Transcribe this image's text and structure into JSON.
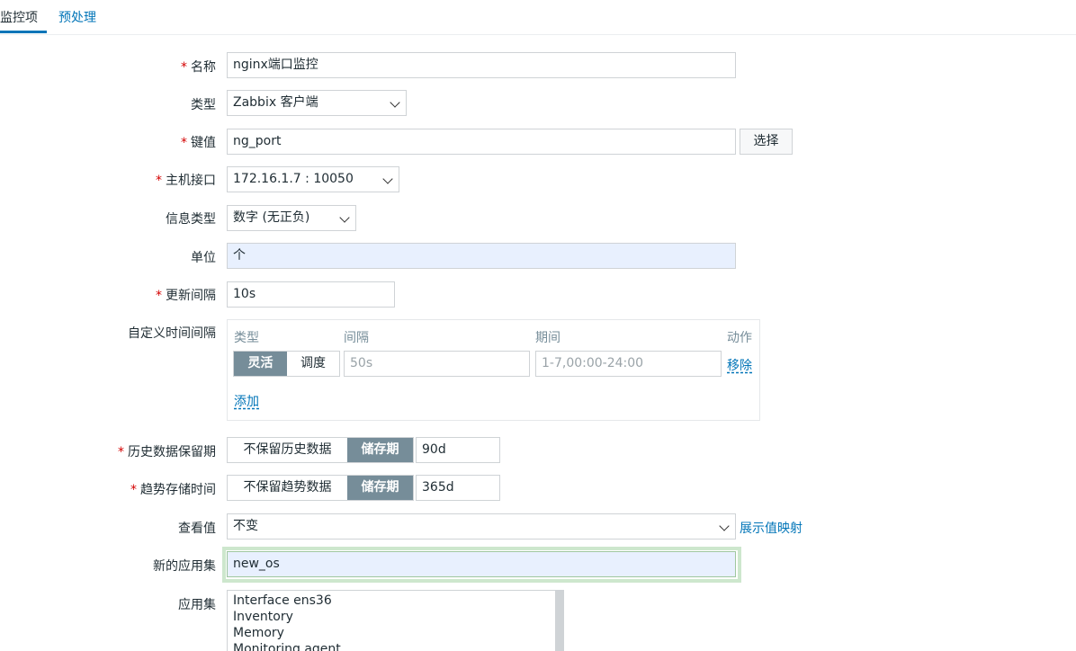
{
  "tabs": [
    {
      "label": "监控项",
      "active": true
    },
    {
      "label": "预处理",
      "active": false
    }
  ],
  "form": {
    "name": {
      "label": "名称",
      "value": "nginx端口监控",
      "required": true
    },
    "type": {
      "label": "类型",
      "value": "Zabbix 客户端"
    },
    "key": {
      "label": "键值",
      "value": "ng_port",
      "required": true,
      "button": "选择"
    },
    "interface": {
      "label": "主机接口",
      "value": "172.16.1.7 : 10050",
      "required": true
    },
    "info_type": {
      "label": "信息类型",
      "value": "数字 (无正负)"
    },
    "unit": {
      "label": "单位",
      "value": "个"
    },
    "update_interval": {
      "label": "更新间隔",
      "value": "10s",
      "required": true
    },
    "custom_intervals": {
      "label": "自定义时间间隔",
      "headers": {
        "type": "类型",
        "interval": "间隔",
        "period": "期间",
        "action": "动作"
      },
      "row": {
        "flexible": "灵活",
        "scheduling": "调度",
        "interval_placeholder": "50s",
        "period_placeholder": "1-7,00:00-24:00",
        "remove": "移除"
      },
      "add": "添加"
    },
    "history": {
      "label": "历史数据保留期",
      "required": true,
      "off_label": "不保留历史数据",
      "on_label": "储存期",
      "value": "90d"
    },
    "trends": {
      "label": "趋势存储时间",
      "required": true,
      "off_label": "不保留趋势数据",
      "on_label": "储存期",
      "value": "365d"
    },
    "show_value": {
      "label": "查看值",
      "value": "不变",
      "link": "展示值映射"
    },
    "new_application": {
      "label": "新的应用集",
      "value": "new_os"
    },
    "applications": {
      "label": "应用集",
      "items": [
        "Interface ens36",
        "Inventory",
        "Memory",
        "Monitoring agent"
      ]
    }
  },
  "colors": {
    "accent": "#0275b8",
    "required": "#d40000",
    "segment_active": "#768d99"
  }
}
